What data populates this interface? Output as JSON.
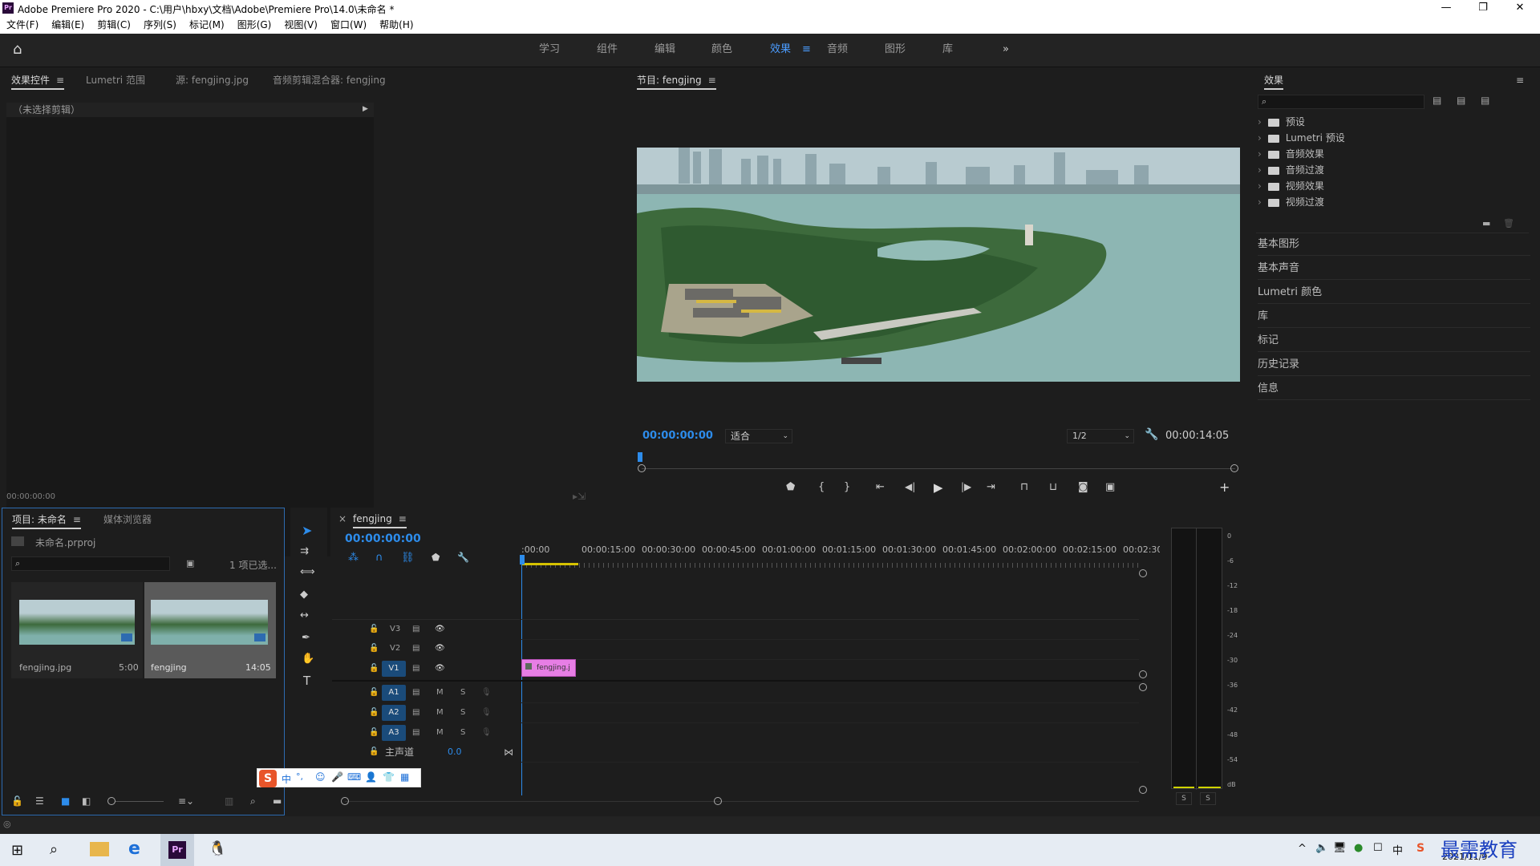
{
  "window": {
    "title": "Adobe Premiere Pro 2020 - C:\\用户\\hbxy\\文档\\Adobe\\Premiere Pro\\14.0\\未命名 *",
    "app_icon": "Pr",
    "minimize": "—",
    "restore": "❐",
    "close": "✕"
  },
  "menu": [
    "文件(F)",
    "编辑(E)",
    "剪辑(C)",
    "序列(S)",
    "标记(M)",
    "图形(G)",
    "视图(V)",
    "窗口(W)",
    "帮助(H)"
  ],
  "workspaces": {
    "items": [
      "学习",
      "组件",
      "编辑",
      "颜色",
      "效果",
      "音频",
      "图形",
      "库"
    ],
    "active": "效果",
    "more": "»"
  },
  "effect_controls": {
    "tabs": [
      "效果控件",
      "Lumetri 范围",
      "源: fengjing.jpg",
      "音频剪辑混合器: fengjing"
    ],
    "no_clip": "（未选择剪辑）",
    "timecode": "00:00:00:00"
  },
  "program": {
    "tab": "节目: fengjing",
    "timecode": "00:00:00:00",
    "fit": "适合",
    "resolution": "1/2",
    "duration": "00:00:14:05"
  },
  "effects": {
    "title": "效果",
    "items": [
      "预设",
      "Lumetri 预设",
      "音频效果",
      "音频过渡",
      "视频效果",
      "视频过渡"
    ],
    "sections": [
      "基本图形",
      "基本声音",
      "Lumetri 颜色",
      "库",
      "标记",
      "历史记录",
      "信息"
    ]
  },
  "project": {
    "tabs": [
      "项目: 未命名",
      "媒体浏览器"
    ],
    "file": "未命名.prproj",
    "selection": "1 项已选...",
    "items": [
      {
        "name": "fengjing.jpg",
        "duration": "5:00"
      },
      {
        "name": "fengjing",
        "duration": "14:05"
      }
    ]
  },
  "timeline": {
    "tab": "fengjing",
    "close": "×",
    "timecode": "00:00:00:00",
    "ruler": [
      ":00:00",
      "00:00:15:00",
      "00:00:30:00",
      "00:00:45:00",
      "00:01:00:00",
      "00:01:15:00",
      "00:01:30:00",
      "00:01:45:00",
      "00:02:00:00",
      "00:02:15:00",
      "00:02:30:0"
    ],
    "video_tracks": [
      "V3",
      "V2",
      "V1"
    ],
    "audio_tracks": [
      "A1",
      "A2",
      "A3"
    ],
    "master": "主声道",
    "master_value": "0.0",
    "clip": "fengjing.j",
    "mute": "M",
    "solo": "S"
  },
  "meter": {
    "scale": [
      "0",
      "-6",
      "-12",
      "-18",
      "-24",
      "-30",
      "-36",
      "-42",
      "-48",
      "-54",
      "dB"
    ],
    "solo": [
      "S",
      "S"
    ]
  },
  "ime": {
    "text": "中",
    "dot": "°,"
  },
  "taskbar": {
    "date": "2021/11/9",
    "watermark": "最需教育"
  },
  "colors": {
    "accent": "#2d8ceb",
    "clip": "#e77ee5",
    "panel": "#1d1d1d"
  }
}
